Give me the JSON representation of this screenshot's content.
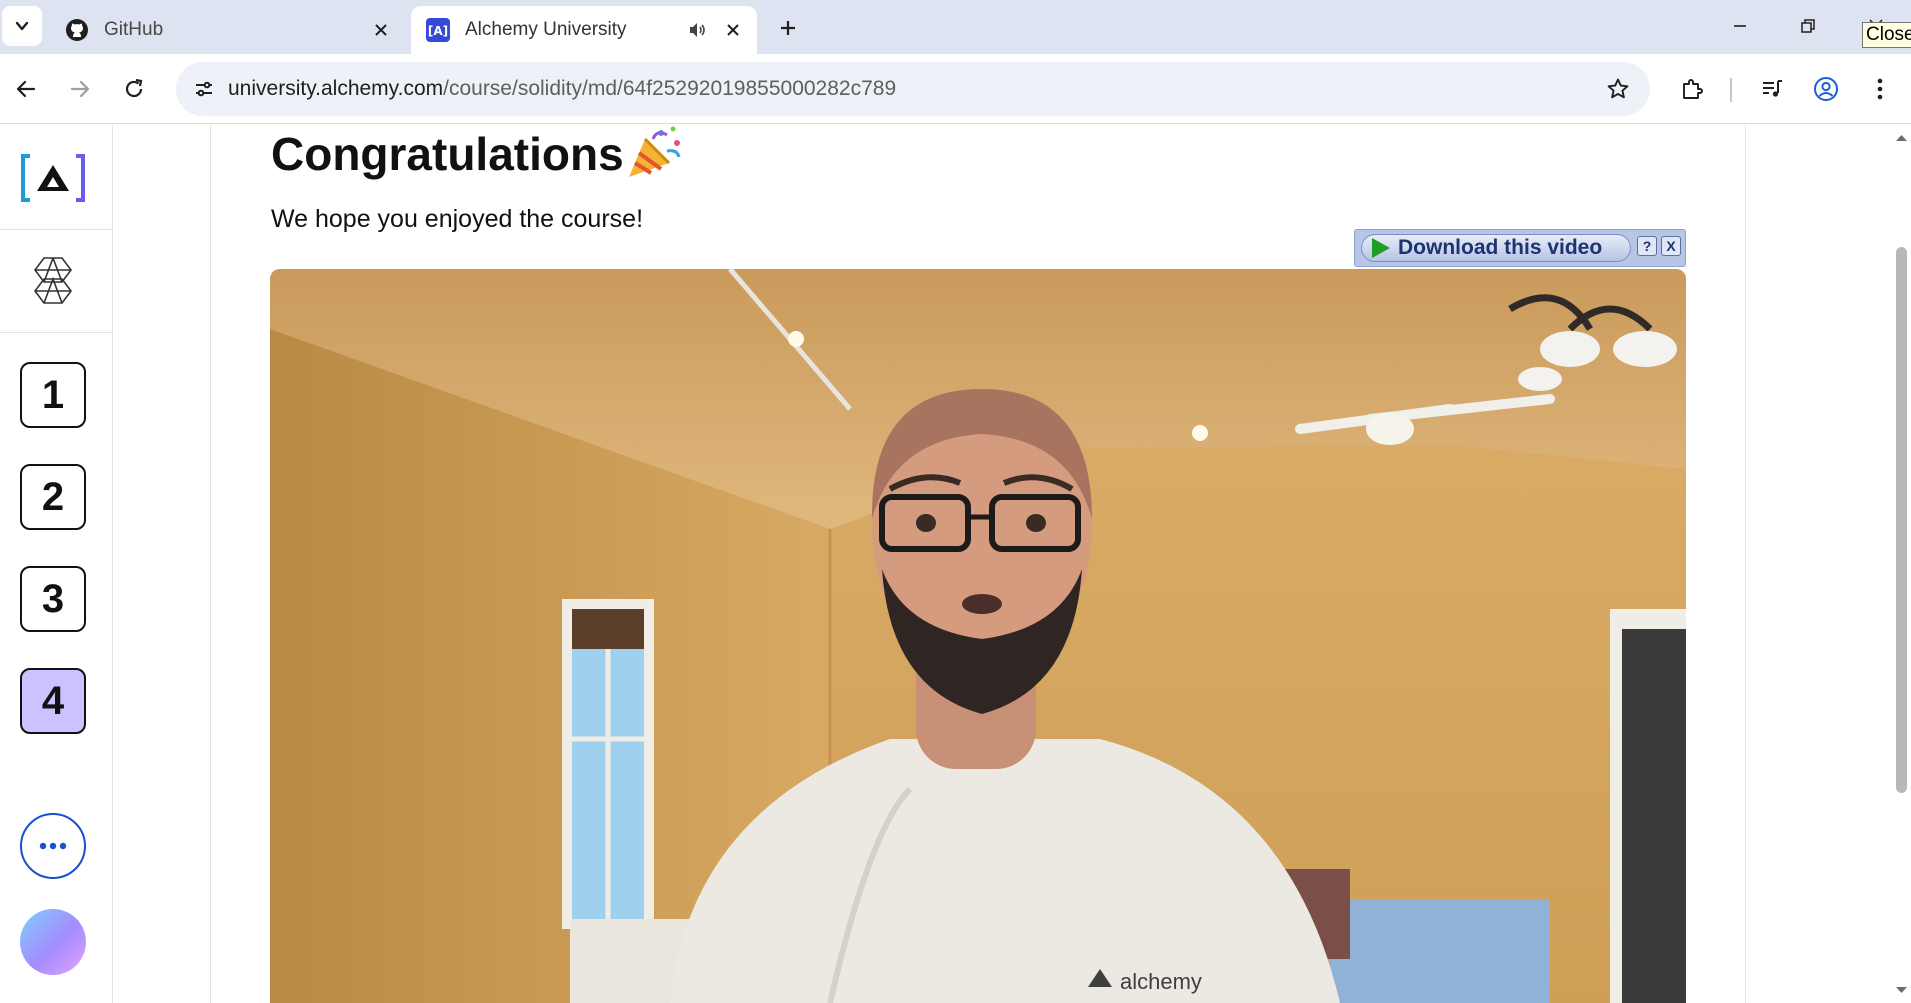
{
  "browser": {
    "tabs": [
      {
        "title": "GitHub",
        "favicon": "github-icon"
      },
      {
        "title": "Alchemy University",
        "favicon": "alchemy-university-icon",
        "active": true,
        "audio": true
      }
    ],
    "url_host": "university.alchemy.com",
    "url_path": "/course/solidity/md/64f25292019855000282c789",
    "tooltip": "Close"
  },
  "sidebar": {
    "steps": [
      "1",
      "2",
      "3",
      "4"
    ],
    "active_step": "4"
  },
  "content": {
    "heading": "Congratulations",
    "subtext": "We hope you enjoyed the course!"
  },
  "video": {
    "download_label": "Download this video",
    "help_label": "?",
    "close_label": "X",
    "shirt_text": "alchemy"
  },
  "colors": {
    "tabstrip": "#dde3f1",
    "active_step": "#cdc2ff",
    "more_button_border": "#1a4fd1"
  }
}
